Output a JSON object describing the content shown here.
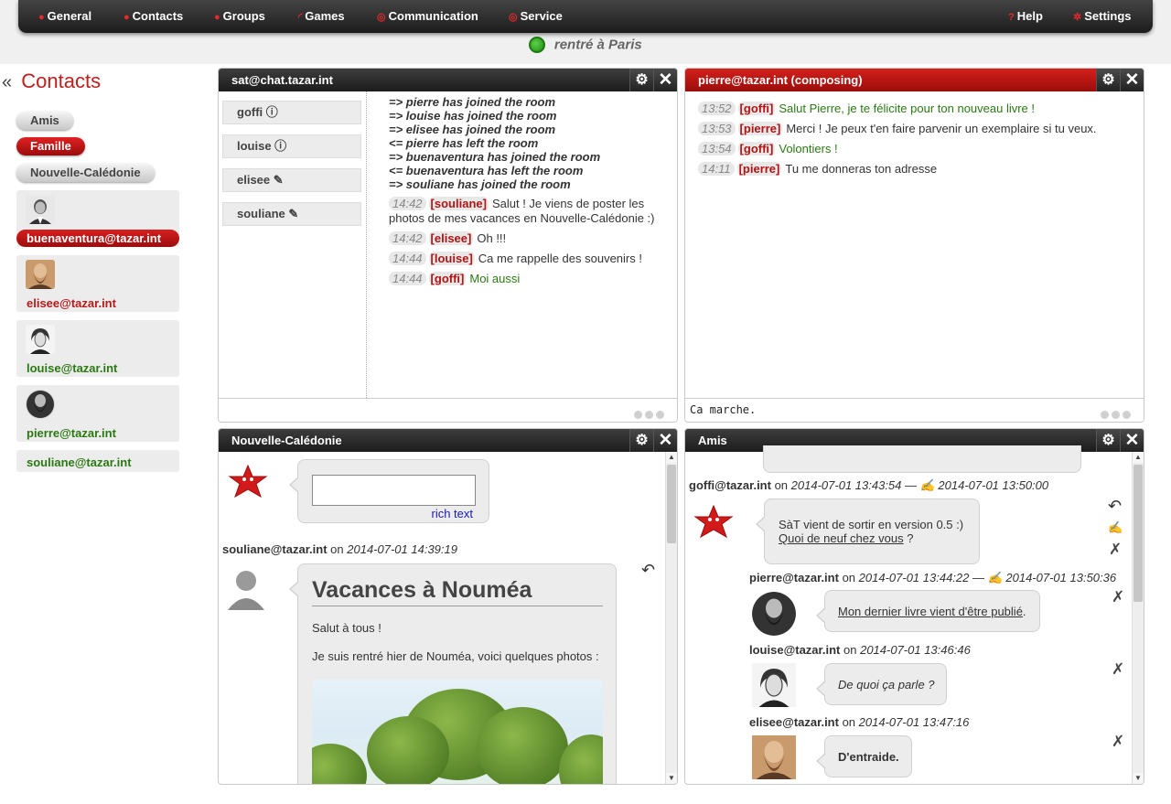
{
  "menu": {
    "items": [
      {
        "label": "General"
      },
      {
        "label": "Contacts"
      },
      {
        "label": "Groups"
      },
      {
        "label": "Games"
      },
      {
        "label": "Communication"
      },
      {
        "label": "Service"
      }
    ],
    "help": "Help",
    "settings": "Settings"
  },
  "status": {
    "text": "rentré à Paris",
    "color": "#2a9a14"
  },
  "contacts": {
    "collapse": "«",
    "title": "Contacts",
    "groups": [
      {
        "label": "Amis",
        "active": false
      },
      {
        "label": "Famille",
        "active": true
      },
      {
        "label": "Nouvelle-Calédonie",
        "active": false
      }
    ],
    "list": [
      {
        "jid": "buenaventura@tazar.int",
        "avatar": "buenaventura-avatar"
      },
      {
        "jid": "elisee@tazar.int",
        "avatar": "elisee-avatar"
      },
      {
        "jid": "louise@tazar.int",
        "avatar": "louise-avatar"
      },
      {
        "jid": "pierre@tazar.int",
        "avatar": "pierre-avatar"
      },
      {
        "jid": "souliane@tazar.int"
      }
    ]
  },
  "muc": {
    "title": "sat@chat.tazar.int",
    "occupants": [
      "goffi ⓘ",
      "louise ⓘ",
      "elisee ✎",
      "souliane ✎"
    ],
    "system": [
      "=> pierre has joined the room",
      "=> louise has joined the room",
      "=> elisee has joined the room",
      "<= pierre has left the room",
      "=> buenaventura has joined the room",
      "<= buenaventura has left the room",
      "=> souliane has joined the room"
    ],
    "messages": [
      {
        "time": "14:42",
        "nick": "[souliane]",
        "text": "Salut ! Je viens de poster les photos de mes vacances en Nouvelle-Calédonie :)"
      },
      {
        "time": "14:42",
        "nick": "[elisee]",
        "text": "Oh !!!"
      },
      {
        "time": "14:44",
        "nick": "[louise]",
        "text": "Ca me rappelle des souvenirs !"
      },
      {
        "time": "14:44",
        "nick": "[goffi]",
        "text": "Moi aussi"
      }
    ]
  },
  "one2one": {
    "title": "pierre@tazar.int (composing)",
    "messages": [
      {
        "time": "13:52",
        "nick": "[goffi]",
        "text": "Salut Pierre, je te félicite pour ton nouveau livre !"
      },
      {
        "time": "13:53",
        "nick": "[pierre]",
        "text": "Merci ! Je peux t'en faire parvenir un exemplaire si tu veux."
      },
      {
        "time": "13:54",
        "nick": "[goffi]",
        "text": "Volontiers !"
      },
      {
        "time": "14:11",
        "nick": "[pierre]",
        "text": "Tu me donneras ton adresse"
      }
    ],
    "input": "Ca marche."
  },
  "blog_nc": {
    "title": "Nouvelle-Calédonie",
    "rich_text": "rich text",
    "post": {
      "author": "souliane@tazar.int",
      "on": "on",
      "date": "2014-07-01 14:39:19",
      "heading": "Vacances à Nouméa",
      "p1": "Salut à tous !",
      "p2": "Je suis rentré hier de Nouméa, voici quelques photos :"
    }
  },
  "blog_amis": {
    "title": "Amis",
    "entries": [
      {
        "author": "goffi@tazar.int",
        "on": "on",
        "date": "2014-07-01 13:43:54 — ✍ 2014-07-01 13:50:00",
        "line1": "SàT vient de sortir en version 0.5 :)",
        "link": "Quoi de neuf chez vous",
        "after": " ?"
      },
      {
        "author": "pierre@tazar.int",
        "on": "on",
        "date": "2014-07-01 13:44:22 — ✍ 2014-07-01 13:50:36",
        "link": "Mon dernier livre vient d'être publié",
        "after": "."
      },
      {
        "author": "louise@tazar.int",
        "on": "on",
        "date": "2014-07-01 13:46:46",
        "text": "De quoi ça parle ?"
      },
      {
        "author": "elisee@tazar.int",
        "on": "on",
        "date": "2014-07-01 13:47:16",
        "text": "D'entraide."
      }
    ]
  },
  "colors": {
    "accent": "#c0201c",
    "green": "#2a7a12",
    "dark": "#222222"
  }
}
